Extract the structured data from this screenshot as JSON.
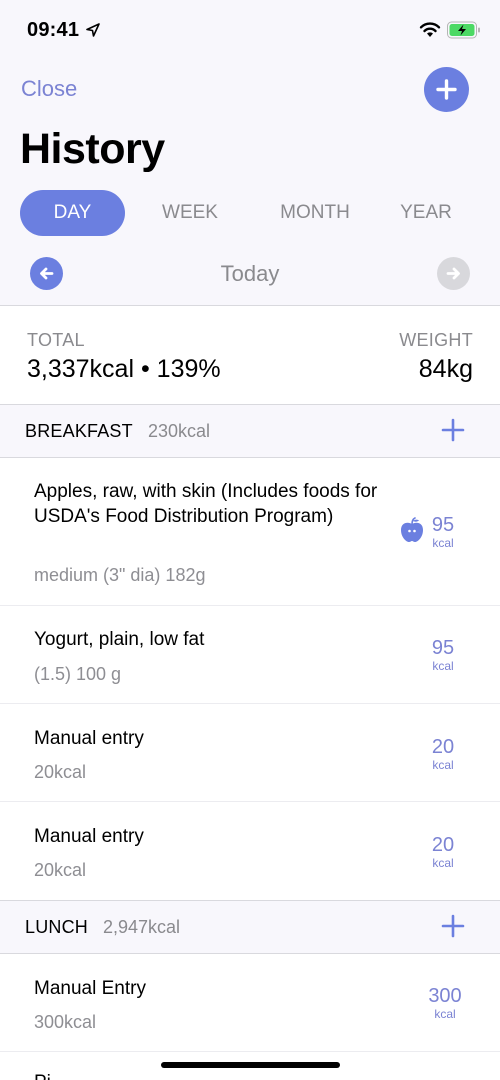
{
  "status_bar": {
    "time": "09:41",
    "icons": [
      "location-arrow-icon",
      "wifi-icon",
      "battery-charging-icon"
    ]
  },
  "nav": {
    "close_label": "Close",
    "add_icon": "plus-icon"
  },
  "page_title": "History",
  "segments": [
    {
      "label": "DAY",
      "active": true
    },
    {
      "label": "WEEK",
      "active": false
    },
    {
      "label": "MONTH",
      "active": false
    },
    {
      "label": "YEAR",
      "active": false
    }
  ],
  "date_nav": {
    "label": "Today",
    "prev_icon": "arrow-left-icon",
    "next_icon": "arrow-right-icon",
    "next_enabled": false
  },
  "summary": {
    "total_label": "TOTAL",
    "total_value": "3,337kcal • 139%",
    "weight_label": "WEIGHT",
    "weight_value": "84kg"
  },
  "sections": [
    {
      "title": "BREAKFAST",
      "kcal": "230kcal",
      "entries": [
        {
          "name": "Apples, raw, with skin (Includes foods for USDA's Food Distribution Program)",
          "detail": "medium (3\" dia) 182g",
          "kcal": "95",
          "unit": "kcal",
          "icon": "apple-icon"
        },
        {
          "name": "Yogurt, plain, low fat",
          "detail": "(1.5) 100 g",
          "kcal": "95",
          "unit": "kcal"
        },
        {
          "name": "Manual entry",
          "detail": "20kcal",
          "kcal": "20",
          "unit": "kcal"
        },
        {
          "name": "Manual entry",
          "detail": "20kcal",
          "kcal": "20",
          "unit": "kcal"
        }
      ]
    },
    {
      "title": "LUNCH",
      "kcal": "2,947kcal",
      "entries": [
        {
          "name": "Manual Entry",
          "detail": "300kcal",
          "kcal": "300",
          "unit": "kcal"
        },
        {
          "name": "Pi",
          "detail": "",
          "kcal": "",
          "unit": ""
        }
      ]
    }
  ],
  "colors": {
    "accent": "#6b7fe0",
    "accent_text": "#7b83d3",
    "secondary_text": "#8a8a8e",
    "background": "#f8f7fc",
    "disabled": "#d8d8dc",
    "battery_green": "#4cd964"
  }
}
